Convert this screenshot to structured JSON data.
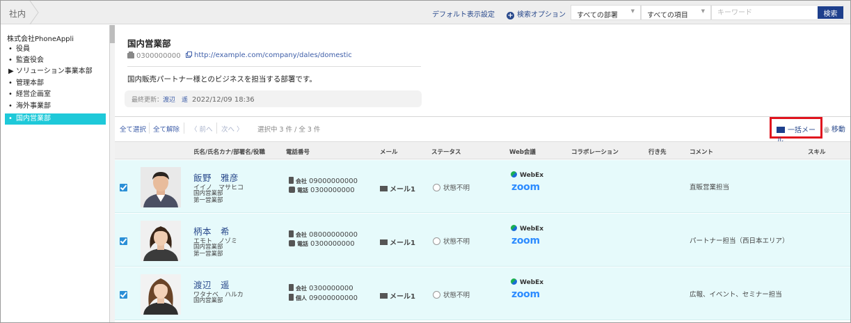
{
  "topbar": {
    "breadcrumb": "社内",
    "default_display": "デフォルト表示設定",
    "search_options": "検索オプション",
    "dept_select": "すべての部署",
    "field_select": "すべての項目",
    "keyword_placeholder": "キーワード",
    "search_button": "検索"
  },
  "tree": {
    "root": "株式会社PhoneAppli",
    "items": [
      {
        "bullet": "•",
        "label": "役員"
      },
      {
        "bullet": "•",
        "label": "監査役会"
      },
      {
        "bullet": "▶",
        "label": "ソリューション事業本部"
      },
      {
        "bullet": "•",
        "label": "管理本部"
      },
      {
        "bullet": "•",
        "label": "経営企画室"
      },
      {
        "bullet": "•",
        "label": "海外事業部"
      },
      {
        "bullet": "•",
        "label": "国内営業部"
      }
    ]
  },
  "dept": {
    "title": "国内営業部",
    "phone": "0300000000",
    "url": "http://example.com/company/dales/domestic",
    "description": "国内販売パートナー様とのビジネスを担当する部署です。",
    "updated_label": "最終更新：",
    "updated_by": "渡辺　遥",
    "updated_at": "2022/12/09 18:36"
  },
  "toolbar": {
    "select_all": "全て選択",
    "deselect_all": "全て解除",
    "prev": "〈 前へ",
    "next": "次へ 〉",
    "selection_count": "選択中 3 件 / 全 3 件",
    "bulk_mail": "一括メール",
    "move": "移動"
  },
  "columns": {
    "name": "氏名/氏名カナ/部署名/役職",
    "phone": "電話番号",
    "mail": "メール",
    "status": "ステータス",
    "web": "Web会議",
    "collab": "コラボレーション",
    "dest": "行き先",
    "comment": "コメント",
    "skill": "スキル"
  },
  "rows": [
    {
      "name": "飯野　雅彦",
      "kana": "イイノ　マサヒコ",
      "dept1": "国内営業部",
      "dept2": "第一営業部",
      "tel1_label": "会社",
      "tel1": "09000000000",
      "tel2_label": "電話",
      "tel2": "0300000000",
      "mail": "メール1",
      "status": "状態不明",
      "webex": "WebEx",
      "zoom": "zoom",
      "comment": "直販営業担当"
    },
    {
      "name": "柄本　希",
      "kana": "エモト　ノゾミ",
      "dept1": "国内営業部",
      "dept2": "第一営業部",
      "tel1_label": "会社",
      "tel1": "08000000000",
      "tel2_label": "電話",
      "tel2": "0300000000",
      "mail": "メール1",
      "status": "状態不明",
      "webex": "WebEx",
      "zoom": "zoom",
      "comment": "パートナー担当（西日本エリア）"
    },
    {
      "name": "渡辺　遥",
      "kana": "ワタナベ　ハルカ",
      "dept1": "国内営業部",
      "dept2": "",
      "tel1_label": "会社",
      "tel1": "0300000000",
      "tel2_label": "個人",
      "tel2": "09000000000",
      "mail": "メール1",
      "status": "状態不明",
      "webex": "WebEx",
      "zoom": "zoom",
      "comment": "広報、イベント、セミナー担当"
    }
  ]
}
